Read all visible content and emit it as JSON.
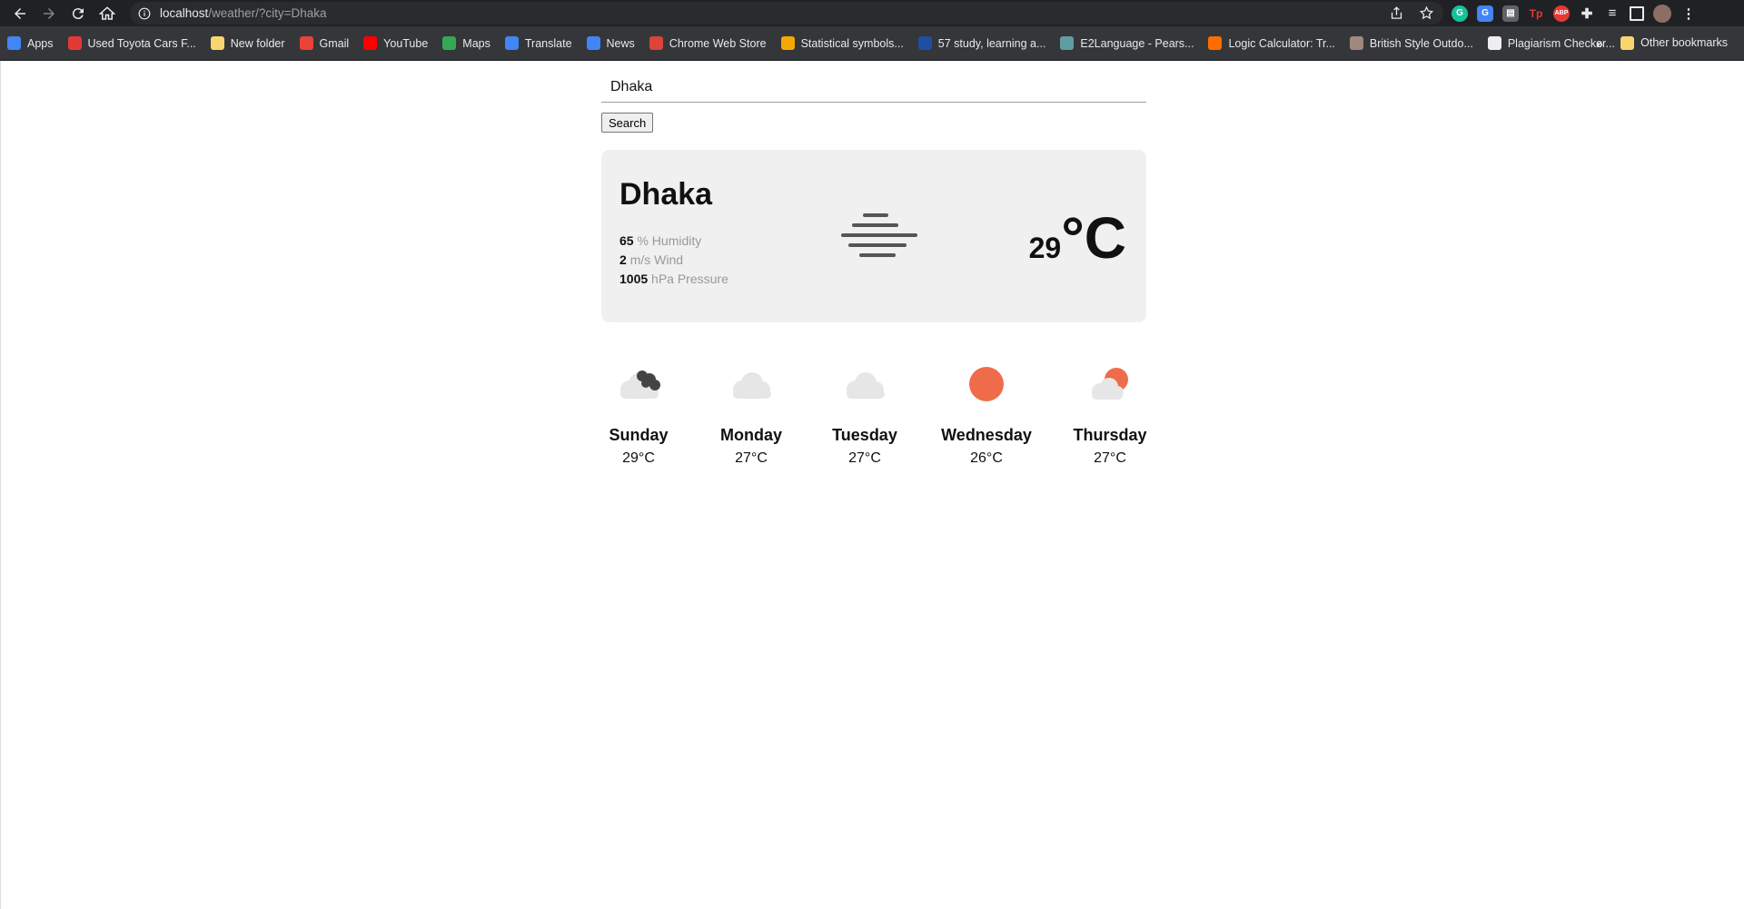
{
  "browser": {
    "url_host": "localhost",
    "url_path": "/weather/?city=Dhaka",
    "bookmarks": [
      {
        "label": "Apps",
        "icon": "apps-grid-icon",
        "color": "#4285f4"
      },
      {
        "label": "Used Toyota Cars F...",
        "icon": "toyota-icon",
        "color": "#e53935"
      },
      {
        "label": "New folder",
        "icon": "folder-icon",
        "color": "#f9d56e"
      },
      {
        "label": "Gmail",
        "icon": "gmail-icon",
        "color": "#ea4335"
      },
      {
        "label": "YouTube",
        "icon": "youtube-icon",
        "color": "#ff0000"
      },
      {
        "label": "Maps",
        "icon": "maps-icon",
        "color": "#34a853"
      },
      {
        "label": "Translate",
        "icon": "translate-icon",
        "color": "#4285f4"
      },
      {
        "label": "News",
        "icon": "news-icon",
        "color": "#4285f4"
      },
      {
        "label": "Chrome Web Store",
        "icon": "webstore-icon",
        "color": "#db4437"
      },
      {
        "label": "Statistical symbols...",
        "icon": "r-icon",
        "color": "#f2a900"
      },
      {
        "label": "57 study, learning a...",
        "icon": "tsr-icon",
        "color": "#1e4fa3"
      },
      {
        "label": "E2Language - Pears...",
        "icon": "e2-icon",
        "color": "#5f9ea0"
      },
      {
        "label": "Logic Calculator: Tr...",
        "icon": "logic-icon",
        "color": "#ff6d00"
      },
      {
        "label": "British Style Outdo...",
        "icon": "jf-icon",
        "color": "#a1887f"
      },
      {
        "label": "Plagiarism Checker...",
        "icon": "sst-icon",
        "color": "#eeeeee"
      }
    ],
    "more_label": "»",
    "other_bookmarks": "Other bookmarks"
  },
  "search": {
    "value": "Dhaka",
    "button_label": "Search"
  },
  "current": {
    "city": "Dhaka",
    "humidity_value": "65",
    "humidity_unit": "% Humidity",
    "wind_value": "2",
    "wind_unit": "m/s Wind",
    "pressure_value": "1005",
    "pressure_unit": "hPa Pressure",
    "temp": "29",
    "temp_unit": "°C",
    "condition_icon": "fog-icon"
  },
  "forecast": [
    {
      "day": "Sunday",
      "temp": "29°C",
      "icon": "cloudy-dark-icon"
    },
    {
      "day": "Monday",
      "temp": "27°C",
      "icon": "cloud-icon"
    },
    {
      "day": "Tuesday",
      "temp": "27°C",
      "icon": "cloud-icon"
    },
    {
      "day": "Wednesday",
      "temp": "26°C",
      "icon": "sun-icon"
    },
    {
      "day": "Thursday",
      "temp": "27°C",
      "icon": "partly-sunny-icon"
    }
  ],
  "colors": {
    "sun": "#ef6c4b",
    "cloud_light": "#e6e6e6",
    "cloud_dark": "#424242",
    "card_bg": "#f0f0f0"
  }
}
